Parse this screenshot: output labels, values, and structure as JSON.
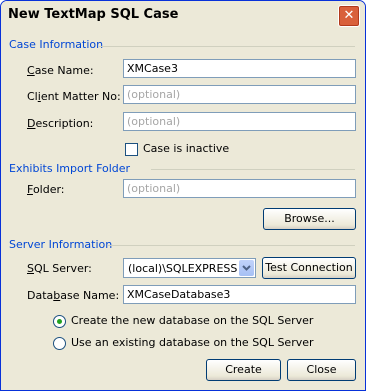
{
  "dialog": {
    "title": "New TextMap SQL Case",
    "close_glyph": "✕"
  },
  "case_information": {
    "header": "Case Information",
    "case_name_label": [
      "",
      "C",
      "ase Name:"
    ],
    "case_name_value": "XMCase3",
    "client_matter_label": [
      "Cl",
      "i",
      "ent Matter No:"
    ],
    "client_matter_value": "(optional)",
    "description_label": [
      "",
      "D",
      "escription:"
    ],
    "description_value": "(optional)",
    "inactive_label": "Case is inactive"
  },
  "exhibits": {
    "header": "Exhibits Import Folder",
    "folder_label": [
      "",
      "F",
      "older:"
    ],
    "folder_value": "(optional)",
    "browse_label": "Browse..."
  },
  "server_information": {
    "header": "Server Information",
    "sql_server_label": [
      "S",
      "Q",
      "L Server:"
    ],
    "sql_server_value": "(local)\\SQLEXPRESS",
    "test_connection_label": "Test Connection",
    "database_name_label": [
      "Data",
      "b",
      "ase Name:"
    ],
    "database_name_value": "XMCaseDatabase3",
    "radio_create_label": "Create the new database on the SQL Server",
    "radio_use_existing_label": "Use an existing database on the SQL Server",
    "selected_radio": "create"
  },
  "footer": {
    "create_label": "Create",
    "close_label": "Close"
  }
}
